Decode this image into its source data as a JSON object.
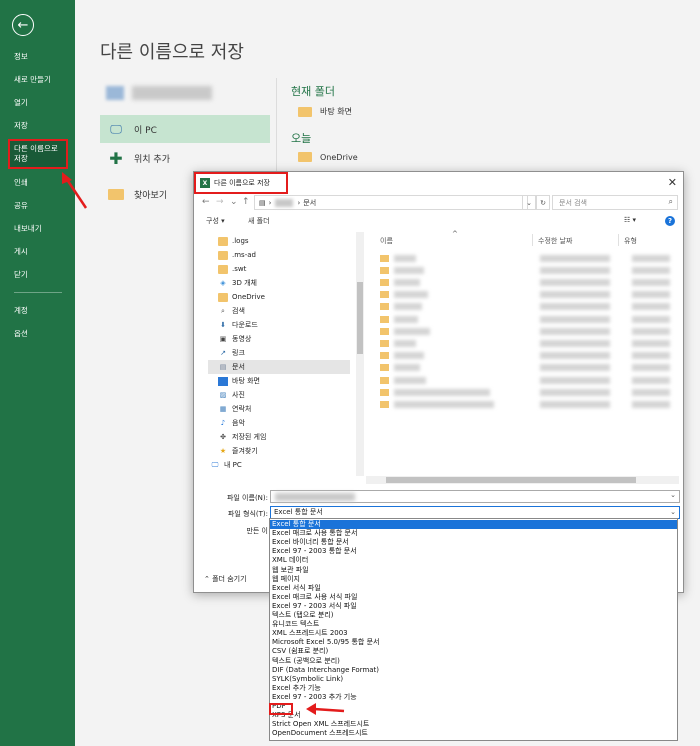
{
  "rail": {
    "back_glyph": "←",
    "items": [
      {
        "label": "정보"
      },
      {
        "label": "새로 만들기"
      },
      {
        "label": "열기"
      },
      {
        "label": "저장"
      },
      {
        "label": "다른 이름으로 저장"
      },
      {
        "label": "인쇄"
      },
      {
        "label": "공유"
      },
      {
        "label": "내보내기"
      },
      {
        "label": "게시"
      },
      {
        "label": "닫기"
      },
      {
        "label": "계정"
      },
      {
        "label": "옵션"
      }
    ]
  },
  "main": {
    "title": "다른 이름으로 저장",
    "locations": [
      {
        "label": "이 PC"
      },
      {
        "label": "위치 추가"
      },
      {
        "label": "찾아보기"
      }
    ],
    "current_folder_title": "현재 폴더",
    "current_folder_item": "바탕 화면",
    "today_title": "오늘",
    "today_item": "OneDrive"
  },
  "dialog": {
    "title": "다른 이름으로 저장",
    "close_glyph": "✕",
    "address_tail": "문서",
    "search_placeholder": "문서 검색",
    "organize": "구성 ▾",
    "new_folder": "새 폴더",
    "view_glyph": "☷ ▾",
    "tree": [
      {
        "label": ".logs",
        "icon": "folder"
      },
      {
        "label": ".ms-ad",
        "icon": "folder"
      },
      {
        "label": ".swt",
        "icon": "folder"
      },
      {
        "label": "3D 개체",
        "icon": "cube"
      },
      {
        "label": "OneDrive",
        "icon": "folder"
      },
      {
        "label": "검색",
        "icon": "search"
      },
      {
        "label": "다운로드",
        "icon": "download"
      },
      {
        "label": "동영상",
        "icon": "video"
      },
      {
        "label": "링크",
        "icon": "link"
      },
      {
        "label": "문서",
        "icon": "doc"
      },
      {
        "label": "바탕 화면",
        "icon": "desktop"
      },
      {
        "label": "사진",
        "icon": "picture"
      },
      {
        "label": "연락처",
        "icon": "contact"
      },
      {
        "label": "음악",
        "icon": "music"
      },
      {
        "label": "저장된 게임",
        "icon": "game"
      },
      {
        "label": "즐겨찾기",
        "icon": "star"
      },
      {
        "label": "내 PC",
        "icon": "pc"
      }
    ],
    "columns": {
      "name": "이름",
      "modified": "수정한 날짜",
      "type": "유형"
    },
    "file_name_label": "파일 이름(N):",
    "file_type_label": "파일 형식(T):",
    "author_label": "만든 이",
    "file_type_value": "Excel 통합 문서",
    "hide_folders": "폴더 숨기기"
  },
  "file_types": [
    "Excel 통합 문서",
    "Excel 매크로 사용 통합 문서",
    "Excel 바이너리 통합 문서",
    "Excel 97 - 2003 통합 문서",
    "XML 데이터",
    "웹 보관 파일",
    "웹 페이지",
    "Excel 서식 파일",
    "Excel 매크로 사용 서식 파일",
    "Excel 97 - 2003 서식 파일",
    "텍스트 (탭으로 분리)",
    "유니코드 텍스트",
    "XML 스프레드시트 2003",
    "Microsoft Excel 5.0/95 통합 문서",
    "CSV (쉼표로 분리)",
    "텍스트 (공백으로 분리)",
    "DIF (Data Interchange Format)",
    "SYLK(Symbolic Link)",
    "Excel 추가 기능",
    "Excel 97 - 2003 추가 기능",
    "PDF",
    "XPS 문서",
    "Strict Open XML 스프레드시트",
    "OpenDocument 스프레드시트"
  ],
  "colors": {
    "brand": "#217346",
    "annotation": "#e31c1c",
    "selection": "#1a73d9"
  }
}
